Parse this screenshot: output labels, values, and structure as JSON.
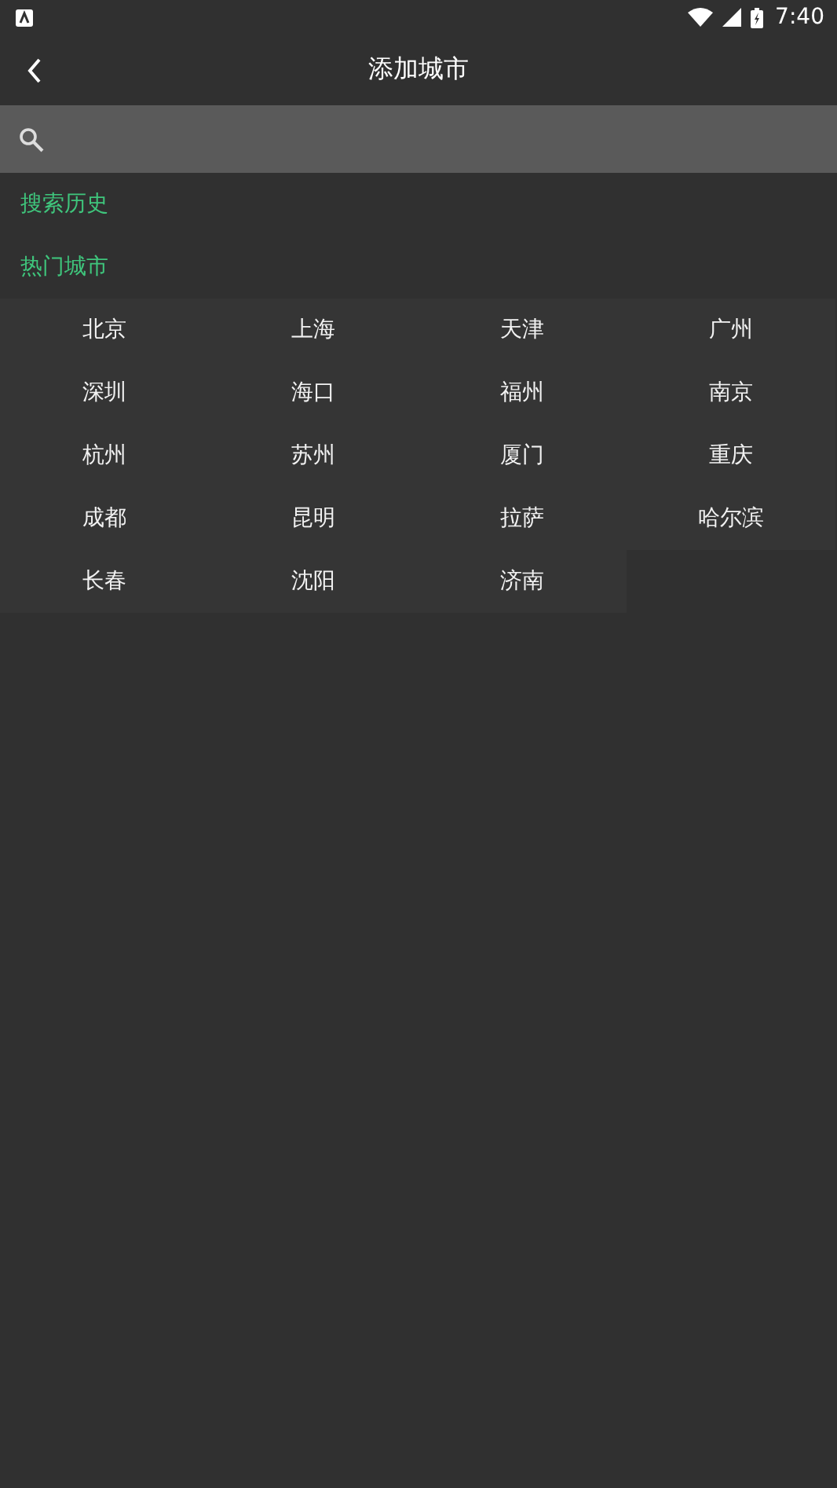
{
  "status_bar": {
    "time": "7:40"
  },
  "toolbar": {
    "title": "添加城市"
  },
  "sections": [
    {
      "title": "搜索历史"
    },
    {
      "title": "热门城市"
    }
  ],
  "cities": [
    "北京",
    "上海",
    "天津",
    "广州",
    "深圳",
    "海口",
    "福州",
    "南京",
    "杭州",
    "苏州",
    "厦门",
    "重庆",
    "成都",
    "昆明",
    "拉萨",
    "哈尔滨",
    "长春",
    "沈阳",
    "济南"
  ]
}
